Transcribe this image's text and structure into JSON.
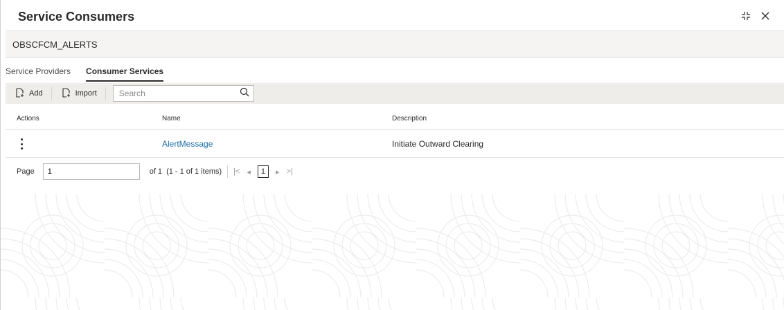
{
  "header": {
    "title": "Service Consumers"
  },
  "name_bar": {
    "value": "OBSCFCM_ALERTS"
  },
  "tabs": [
    {
      "label": "Service Providers",
      "active": false
    },
    {
      "label": "Consumer Services",
      "active": true
    }
  ],
  "toolbar": {
    "add_label": "Add",
    "import_label": "Import",
    "search_placeholder": "Search",
    "search_value": ""
  },
  "table": {
    "columns": [
      "Actions",
      "Name",
      "Description"
    ],
    "rows": [
      {
        "name": "AlertMessage",
        "description": "Initiate Outward Clearing"
      }
    ]
  },
  "pagination": {
    "page_label": "Page",
    "page_value": "1",
    "of_text": "of 1",
    "range_text": "(1 - 1 of 1 items)",
    "current_page": "1"
  },
  "colors": {
    "link": "#1f6fa6",
    "toolbar_bg": "#efedea",
    "namebar_bg": "#f5f4f2"
  },
  "icons": {
    "collapse": "collapse-arrows-icon",
    "close": "close-icon",
    "add": "add-document-icon",
    "import": "import-document-icon",
    "search": "search-icon",
    "row_actions": "kebab-menu-icon"
  }
}
